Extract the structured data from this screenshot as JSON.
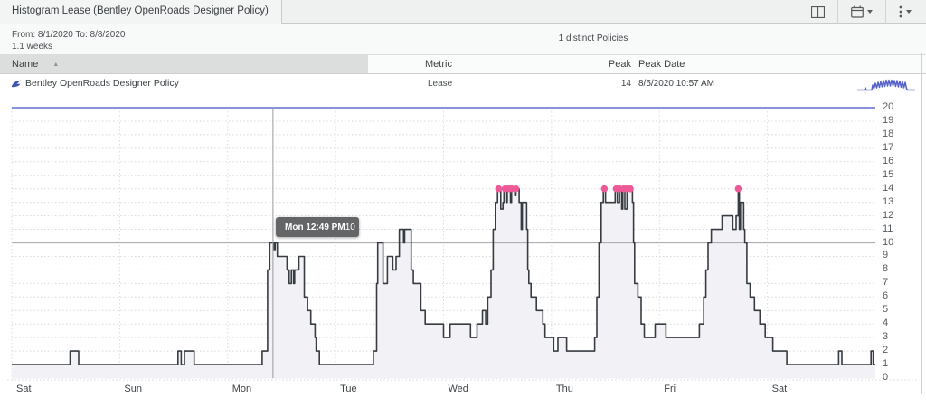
{
  "header": {
    "title": "Histogram Lease (Bentley OpenRoads Designer Policy)"
  },
  "info_bar": {
    "range": "From: 8/1/2020 To: 8/8/2020",
    "duration": "1.1 weeks",
    "distinct": "1 distinct Policies"
  },
  "table": {
    "col_name": "Name",
    "col_metric": "Metric",
    "col_peak": "Peak",
    "col_peak_date": "Peak Date",
    "sort_icon": "asc",
    "row_name": "Bentley OpenRoads Designer Policy",
    "row_metric": "Lease",
    "row_peak": "14",
    "row_peak_date": "8/5/2020 10:57 AM"
  },
  "tooltip": {
    "label": "Mon 12:49 PM",
    "value": "10"
  },
  "chart_data": {
    "type": "area",
    "title": "Histogram Lease (Bentley OpenRoads Designer Policy)",
    "xlabel": "",
    "ylabel": "",
    "x_labels": [
      "Sat",
      "Sun",
      "Mon",
      "Tue",
      "Wed",
      "Thu",
      "Fri",
      "Sat"
    ],
    "x_range_days": [
      0,
      8
    ],
    "ylim": [
      0,
      20
    ],
    "y_tick_step": 1,
    "grid": true,
    "legend": false,
    "limit_line_value": 20,
    "hover": {
      "x_day": 2.42,
      "value": 10,
      "label": "Mon 12:49 PM"
    },
    "peak_value": 14,
    "peak_dot_days": [
      4.51,
      4.57,
      4.6,
      4.63,
      4.67,
      5.49,
      5.6,
      5.63,
      5.67,
      5.7,
      5.73,
      6.73
    ],
    "steps_day_value": [
      [
        0,
        1
      ],
      [
        0.54,
        2
      ],
      [
        0.62,
        1
      ],
      [
        1.54,
        2
      ],
      [
        1.57,
        1
      ],
      [
        1.6,
        2
      ],
      [
        1.69,
        1
      ],
      [
        2.32,
        2
      ],
      [
        2.37,
        8
      ],
      [
        2.39,
        10
      ],
      [
        2.43,
        9.5
      ],
      [
        2.44,
        10
      ],
      [
        2.46,
        9
      ],
      [
        2.55,
        8
      ],
      [
        2.57,
        7
      ],
      [
        2.59,
        8
      ],
      [
        2.61,
        7
      ],
      [
        2.62,
        8
      ],
      [
        2.66,
        9
      ],
      [
        2.71,
        6
      ],
      [
        2.74,
        5
      ],
      [
        2.77,
        4
      ],
      [
        2.81,
        3
      ],
      [
        2.82,
        2
      ],
      [
        2.85,
        1
      ],
      [
        3.35,
        2
      ],
      [
        3.38,
        7
      ],
      [
        3.39,
        10
      ],
      [
        3.44,
        7
      ],
      [
        3.48,
        9
      ],
      [
        3.53,
        8
      ],
      [
        3.56,
        9
      ],
      [
        3.59,
        11
      ],
      [
        3.63,
        10
      ],
      [
        3.64,
        11
      ],
      [
        3.7,
        8
      ],
      [
        3.72,
        7
      ],
      [
        3.79,
        5
      ],
      [
        3.83,
        4
      ],
      [
        4,
        3
      ],
      [
        4.06,
        4
      ],
      [
        4.25,
        3
      ],
      [
        4.31,
        4
      ],
      [
        4.36,
        5
      ],
      [
        4.39,
        4
      ],
      [
        4.41,
        6
      ],
      [
        4.44,
        8
      ],
      [
        4.46,
        11
      ],
      [
        4.48,
        13
      ],
      [
        4.5,
        14
      ],
      [
        4.53,
        12.5
      ],
      [
        4.55,
        13
      ],
      [
        4.56,
        14
      ],
      [
        4.58,
        13
      ],
      [
        4.59,
        14
      ],
      [
        4.62,
        13
      ],
      [
        4.63,
        14
      ],
      [
        4.66,
        13.5
      ],
      [
        4.67,
        14
      ],
      [
        4.7,
        13
      ],
      [
        4.72,
        11
      ],
      [
        4.73,
        13
      ],
      [
        4.77,
        11
      ],
      [
        4.78,
        8
      ],
      [
        4.79,
        7
      ],
      [
        4.81,
        6
      ],
      [
        4.86,
        5
      ],
      [
        4.92,
        4
      ],
      [
        4.94,
        3
      ],
      [
        5.02,
        2
      ],
      [
        5.06,
        3
      ],
      [
        5.14,
        2
      ],
      [
        5.4,
        3
      ],
      [
        5.42,
        6
      ],
      [
        5.44,
        10
      ],
      [
        5.46,
        13
      ],
      [
        5.48,
        14
      ],
      [
        5.5,
        13
      ],
      [
        5.59,
        14
      ],
      [
        5.61,
        13
      ],
      [
        5.63,
        14
      ],
      [
        5.65,
        12.5
      ],
      [
        5.66,
        14
      ],
      [
        5.68,
        12.5
      ],
      [
        5.7,
        14
      ],
      [
        5.75,
        13
      ],
      [
        5.76,
        10
      ],
      [
        5.77,
        7
      ],
      [
        5.8,
        6
      ],
      [
        5.83,
        4
      ],
      [
        5.86,
        3
      ],
      [
        5.96,
        4
      ],
      [
        6.06,
        3
      ],
      [
        6.37,
        4
      ],
      [
        6.41,
        6
      ],
      [
        6.43,
        8
      ],
      [
        6.45,
        10
      ],
      [
        6.48,
        11
      ],
      [
        6.58,
        12
      ],
      [
        6.68,
        11
      ],
      [
        6.71,
        12
      ],
      [
        6.73,
        14
      ],
      [
        6.74,
        11
      ],
      [
        6.75,
        13
      ],
      [
        6.78,
        11
      ],
      [
        6.79,
        10
      ],
      [
        6.81,
        7
      ],
      [
        6.84,
        6
      ],
      [
        6.88,
        5
      ],
      [
        6.93,
        4
      ],
      [
        6.98,
        3
      ],
      [
        7.05,
        2
      ],
      [
        7.18,
        1
      ],
      [
        7.66,
        2
      ],
      [
        7.69,
        1
      ],
      [
        7.96,
        2
      ],
      [
        7.98,
        1
      ]
    ]
  },
  "sparkline": {
    "points": [
      [
        0,
        15.5
      ],
      [
        8,
        15.5
      ],
      [
        9,
        13
      ],
      [
        10,
        15.5
      ],
      [
        16,
        15.5
      ],
      [
        17,
        10
      ],
      [
        18.5,
        14
      ],
      [
        20,
        8
      ],
      [
        21.5,
        13
      ],
      [
        23,
        7
      ],
      [
        24.5,
        12.5
      ],
      [
        26,
        6
      ],
      [
        27.5,
        12
      ],
      [
        29,
        5
      ],
      [
        30.5,
        11.5
      ],
      [
        32,
        4.5
      ],
      [
        33.5,
        11
      ],
      [
        35,
        4.5
      ],
      [
        36.5,
        11
      ],
      [
        38,
        4.5
      ],
      [
        39.5,
        11
      ],
      [
        41,
        5
      ],
      [
        42.5,
        11.5
      ],
      [
        44,
        5
      ],
      [
        45.5,
        12
      ],
      [
        47,
        5.5
      ],
      [
        48.5,
        12.5
      ],
      [
        50,
        6
      ],
      [
        51.5,
        13
      ],
      [
        53,
        7
      ],
      [
        54.5,
        14
      ],
      [
        56,
        15.5
      ],
      [
        64,
        15.5
      ]
    ]
  },
  "colors": {
    "accent_pink": "#ee5a97",
    "limit_indigo": "#7d89d6",
    "series_line": "#363c41",
    "area_fill": "#f2f2f6",
    "sparkline": "#5763c8",
    "grid": "#d8d8dd",
    "grid_vertical": "#dcdce1",
    "crosshair": "#9b9b9b",
    "hover_level": "#aeaeb4",
    "bentley_blue": "#4053b4"
  }
}
